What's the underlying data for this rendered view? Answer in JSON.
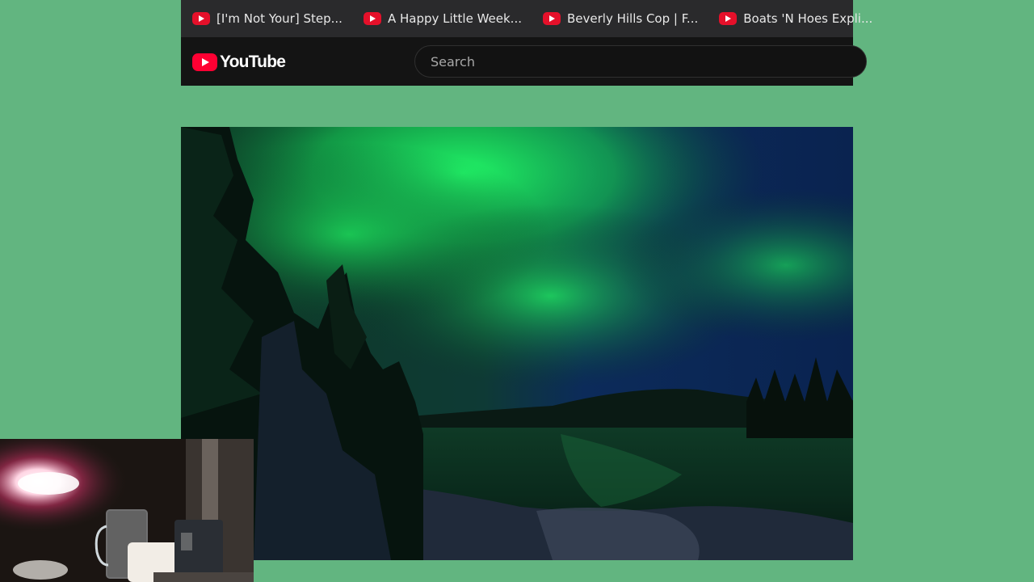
{
  "bookmarks": [
    {
      "label": "[I'm Not Your] Step...",
      "icon": "youtube-icon"
    },
    {
      "label": "A Happy Little Week...",
      "icon": "youtube-icon"
    },
    {
      "label": "Beverly Hills Cop | F...",
      "icon": "youtube-icon"
    },
    {
      "label": "Boats 'N Hoes Expli...",
      "icon": "youtube-icon"
    }
  ],
  "header": {
    "logo_text": "YouTube",
    "search_placeholder": "Search"
  },
  "colors": {
    "background": "#62b580",
    "youtube_red": "#ff0033",
    "header_bg": "#141414",
    "bookmark_bar_bg": "#2a2a2c"
  }
}
